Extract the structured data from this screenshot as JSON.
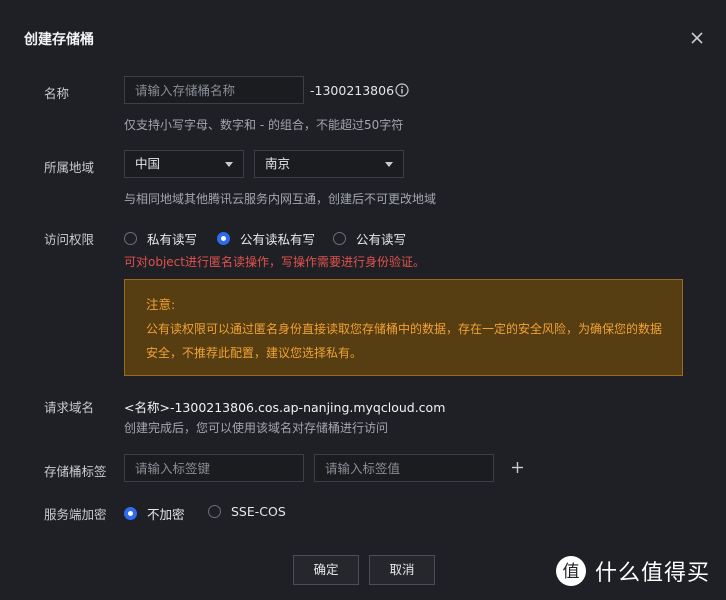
{
  "dialog": {
    "title": "创建存储桶"
  },
  "name": {
    "label": "名称",
    "placeholder": "请输入存储桶名称",
    "suffix": "-1300213806",
    "hint": "仅支持小写字母、数字和 - 的组合，不能超过50字符"
  },
  "region": {
    "label": "所属地域",
    "country": "中国",
    "city": "南京",
    "hint": "与相同地域其他腾讯云服务内网互通，创建后不可更改地域"
  },
  "access": {
    "label": "访问权限",
    "options": [
      "私有读写",
      "公有读私有写",
      "公有读写"
    ],
    "selected": "公有读私有写",
    "warning": "可对object进行匿名读操作，写操作需要进行身份验证。",
    "notice_title": "注意:",
    "notice_body": "公有读权限可以通过匿名身份直接读取您存储桶中的数据，存在一定的安全风险，为确保您的数据安全，不推荐此配置，建议您选择私有。"
  },
  "request_domain": {
    "label": "请求域名",
    "value": "<名称>-1300213806.cos.ap-nanjing.myqcloud.com",
    "hint": "创建完成后，您可以使用该域名对存储桶进行访问"
  },
  "tags": {
    "label": "存储桶标签",
    "key_placeholder": "请输入标签键",
    "value_placeholder": "请输入标签值"
  },
  "encryption": {
    "label": "服务端加密",
    "options": [
      "不加密",
      "SSE-COS"
    ],
    "selected": "不加密"
  },
  "buttons": {
    "confirm": "确定",
    "cancel": "取消"
  },
  "watermark": {
    "text": "什么值得买",
    "logo_char": "值"
  },
  "colors": {
    "accent": "#2d6bf0",
    "warning_text": "#f0a236",
    "error_text": "#e0524d",
    "background": "#1f2025"
  }
}
